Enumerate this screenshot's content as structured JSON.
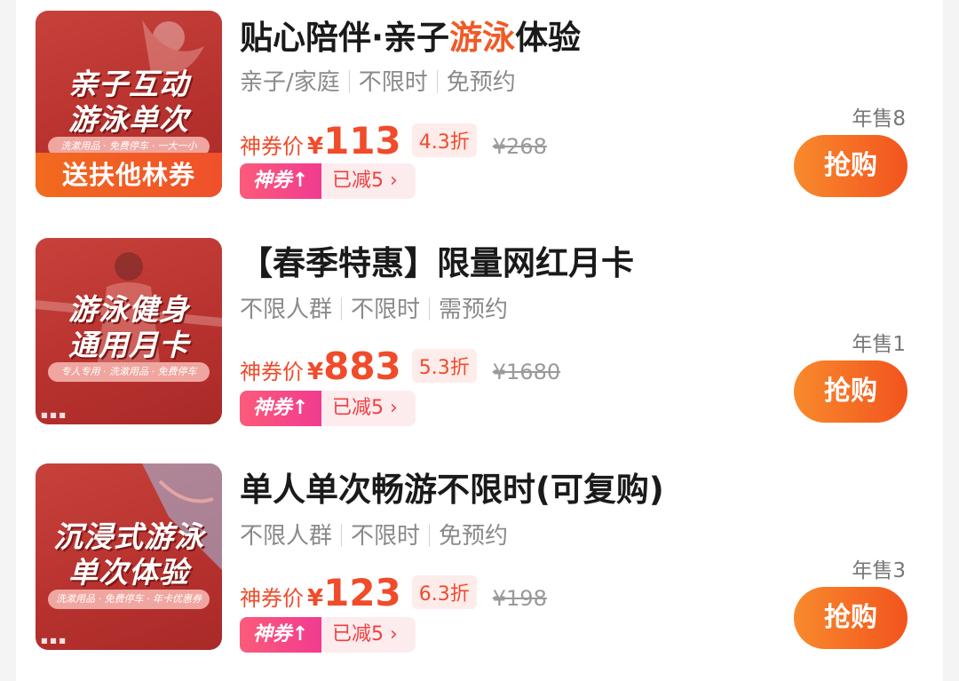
{
  "items": [
    {
      "thumb": {
        "line1": "亲子互动",
        "line2": "游泳单次",
        "strip": "洗漱用品 · 免费停车 · 一大一小",
        "band": "送扶他林券"
      },
      "title_pre": "贴心陪伴·亲子",
      "title_hl": "游泳",
      "title_post": "体验",
      "tags": [
        "亲子/家庭",
        "不限时",
        "免预约"
      ],
      "price_label": "神券价",
      "currency": "¥",
      "price": "113",
      "discount": "4.3折",
      "orig_price": "¥268",
      "coupon_left": "神券↑",
      "coupon_right": "已减5 ›",
      "sold": "年售8",
      "buy": "抢购"
    },
    {
      "thumb": {
        "line1": "游泳健身",
        "line2": "通用月卡",
        "strip": "专人专用 · 洗漱用品 · 免费停车"
      },
      "title": "【春季特惠】限量网红月卡",
      "tags": [
        "不限人群",
        "不限时",
        "需预约"
      ],
      "price_label": "神券价",
      "currency": "¥",
      "price": "883",
      "discount": "5.3折",
      "orig_price": "¥1680",
      "coupon_left": "神券↑",
      "coupon_right": "已减5 ›",
      "sold": "年售1",
      "buy": "抢购"
    },
    {
      "thumb": {
        "line1": "沉浸式游泳",
        "line2": "单次体验",
        "strip": "洗漱用品 · 免费停车 · 年卡优惠券"
      },
      "title": "单人单次畅游不限时(可复购)",
      "tags": [
        "不限人群",
        "不限时",
        "免预约"
      ],
      "price_label": "神券价",
      "currency": "¥",
      "price": "123",
      "discount": "6.3折",
      "orig_price": "¥198",
      "coupon_left": "神券↑",
      "coupon_right": "已减5 ›",
      "sold": "年售3",
      "buy": "抢购"
    }
  ]
}
